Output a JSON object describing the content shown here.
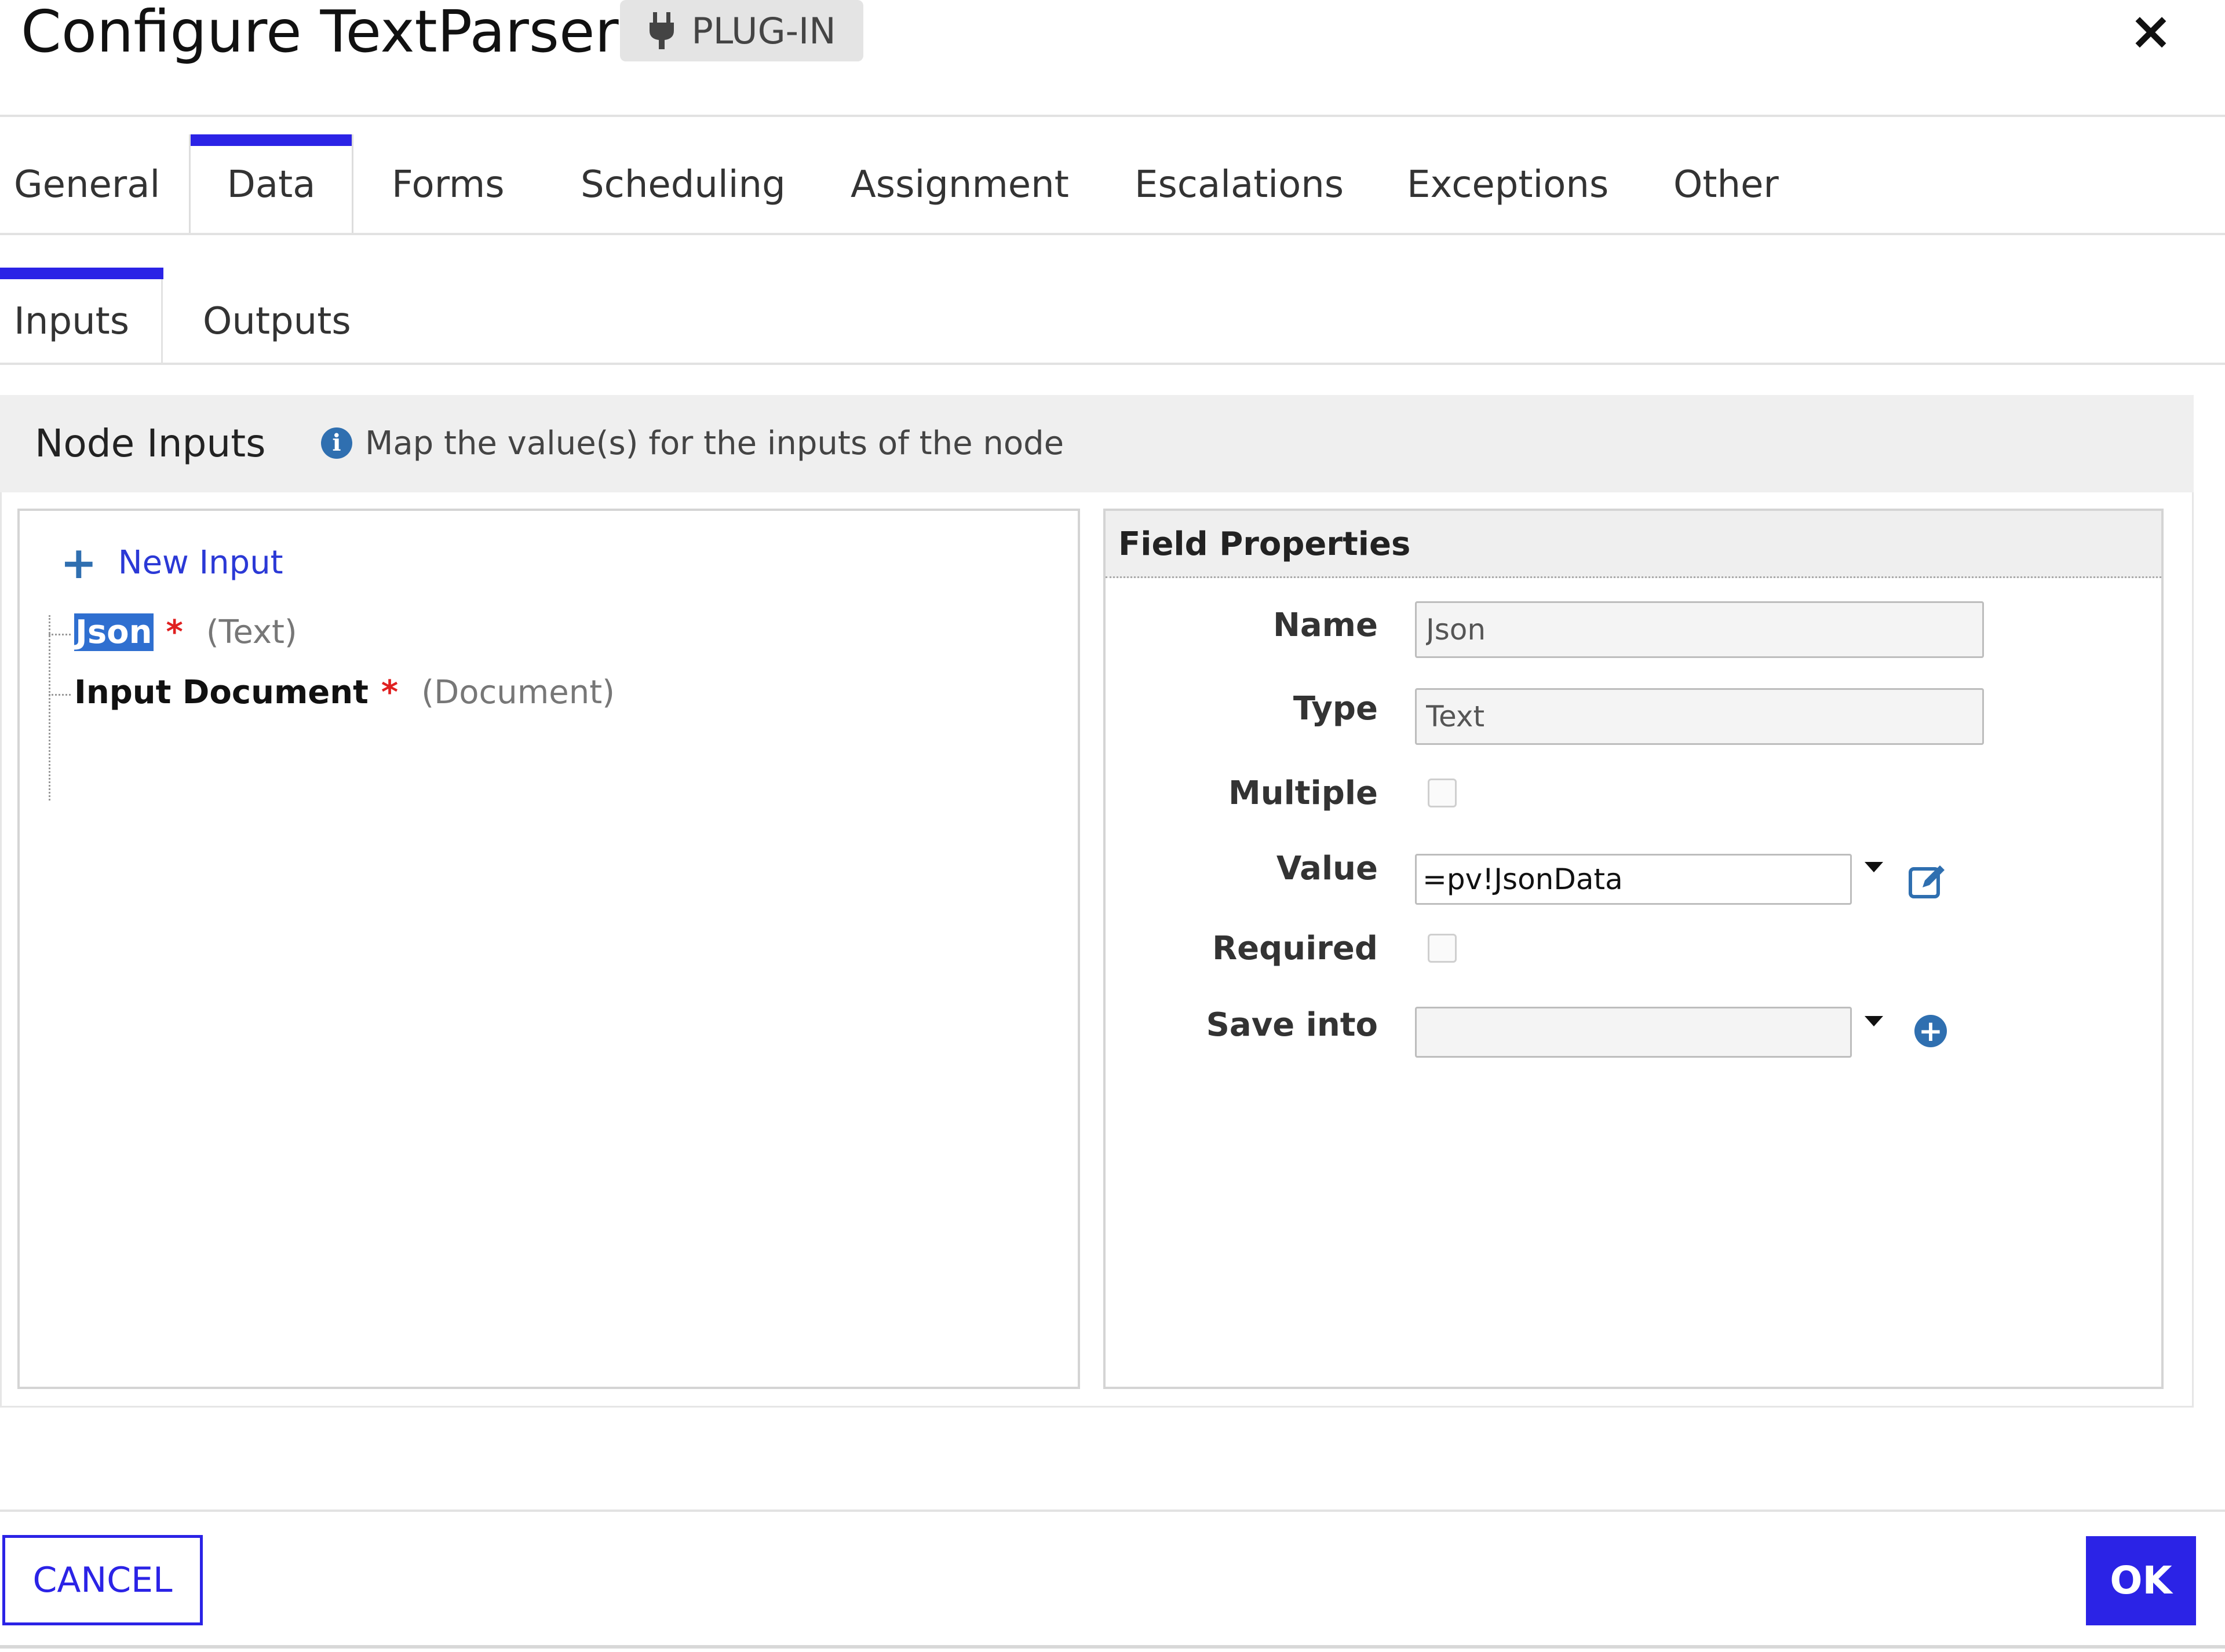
{
  "dialog": {
    "title": "Configure TextParser",
    "badge": "PLUG-IN",
    "close_label": "×"
  },
  "tabs": [
    {
      "label": "General"
    },
    {
      "label": "Data"
    },
    {
      "label": "Forms"
    },
    {
      "label": "Scheduling"
    },
    {
      "label": "Assignment"
    },
    {
      "label": "Escalations"
    },
    {
      "label": "Exceptions"
    },
    {
      "label": "Other"
    }
  ],
  "active_tab": "Data",
  "subtabs": [
    {
      "label": "Inputs"
    },
    {
      "label": "Outputs"
    }
  ],
  "active_subtab": "Inputs",
  "node_inputs": {
    "title": "Node Inputs",
    "info": "Map the value(s) for the inputs of the node",
    "new_input_label": "New Input",
    "items": [
      {
        "name": "Json",
        "required": "*",
        "type": "(Text)",
        "selected": true
      },
      {
        "name": "Input Document",
        "required": "*",
        "type": "(Document)",
        "selected": false
      }
    ]
  },
  "field_properties": {
    "title": "Field Properties",
    "name_label": "Name",
    "name_value": "Json",
    "type_label": "Type",
    "type_value": "Text",
    "multiple_label": "Multiple",
    "multiple_checked": false,
    "value_label": "Value",
    "value_value": "=pv!JsonData",
    "required_label": "Required",
    "required_checked": false,
    "save_into_label": "Save into",
    "save_into_value": ""
  },
  "footer": {
    "cancel_label": "CANCEL",
    "ok_label": "OK"
  },
  "colors": {
    "accent": "#2b23e6",
    "link": "#2b39d6",
    "icon_blue": "#2f6fb0",
    "required": "#e02020"
  }
}
